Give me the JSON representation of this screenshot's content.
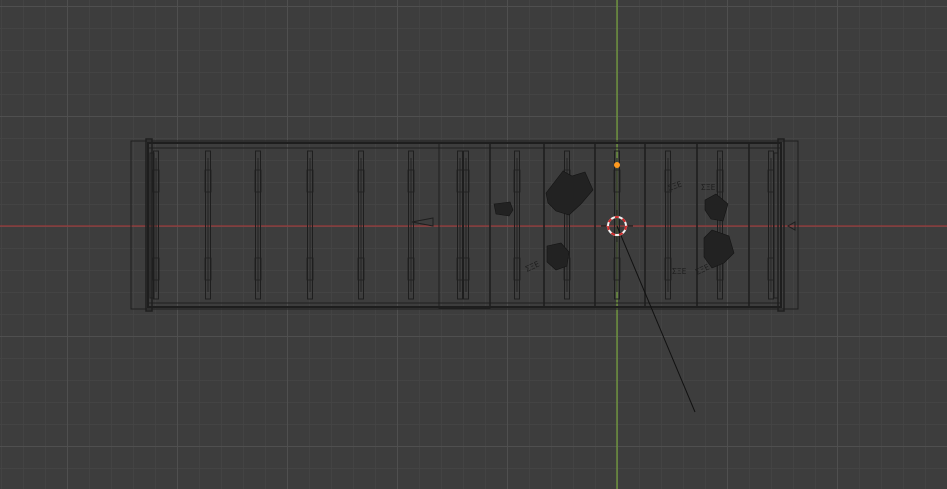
{
  "app": "Blender",
  "viewport": {
    "view": "top-orthographic",
    "shading": "wireframe",
    "grid": true,
    "colors": {
      "background": "#3d3d3d",
      "x_axis": "#9a3a3a",
      "y_axis": "#76a43b",
      "wire": "#1e1e1e",
      "origin_dot": "#ff9a1f",
      "cursor_red": "#d12b2b",
      "cursor_white": "#f2f2f2"
    },
    "objects": [
      {
        "name": "container-frame",
        "type": "mesh"
      },
      {
        "name": "debris-cluster",
        "type": "mesh"
      },
      {
        "name": "camera",
        "type": "camera"
      }
    ],
    "cursor": "3d-cursor",
    "selected_origin": true
  }
}
